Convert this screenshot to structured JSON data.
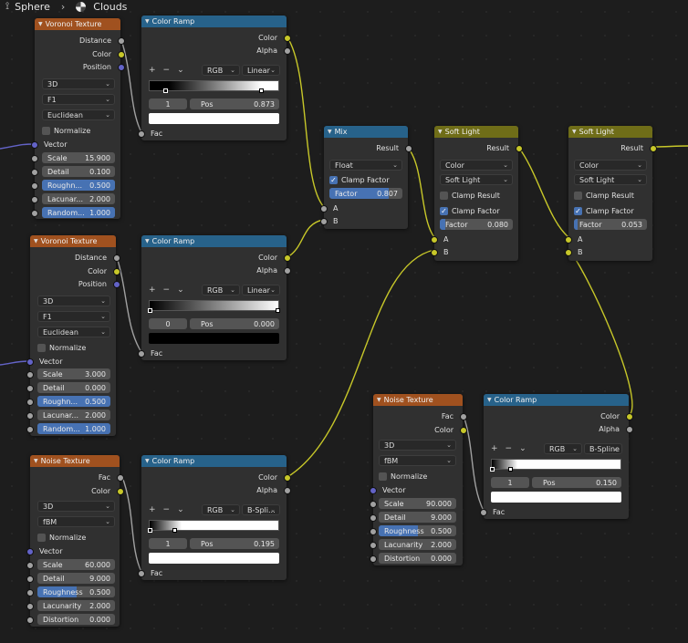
{
  "breadcrumb": {
    "object": "Sphere",
    "material": "Clouds"
  },
  "colors": {
    "texture_header": "#a0511f",
    "converter_header": "#27628a",
    "color_header": "#6f6d18",
    "field_fill": "#4772b3",
    "socket_vector": "#6363c7",
    "socket_color": "#c7c729",
    "socket_float": "#a1a1a1"
  },
  "voronoi1": {
    "title": "Voronoi Texture",
    "outputs": [
      "Distance",
      "Color",
      "Position"
    ],
    "dim": "3D",
    "feature": "F1",
    "metric": "Euclidean",
    "normalize": "Normalize",
    "vector": "Vector",
    "fields": [
      {
        "label": "Scale",
        "value": "15.900"
      },
      {
        "label": "Detail",
        "value": "0.100"
      },
      {
        "label": "Roughn...",
        "value": "0.500",
        "fill": 1
      },
      {
        "label": "Lacunar...",
        "value": "2.000"
      },
      {
        "label": "Random...",
        "value": "1.000",
        "fill": 1
      }
    ]
  },
  "voronoi2": {
    "title": "Voronoi Texture",
    "outputs": [
      "Distance",
      "Color",
      "Position"
    ],
    "dim": "3D",
    "feature": "F1",
    "metric": "Euclidean",
    "normalize": "Normalize",
    "vector": "Vector",
    "fields": [
      {
        "label": "Scale",
        "value": "3.000"
      },
      {
        "label": "Detail",
        "value": "0.000"
      },
      {
        "label": "Roughn...",
        "value": "0.500",
        "fill": 1
      },
      {
        "label": "Lacunar...",
        "value": "2.000"
      },
      {
        "label": "Random...",
        "value": "1.000",
        "fill": 1
      }
    ]
  },
  "noise1": {
    "title": "Noise Texture",
    "outputs": [
      "Fac",
      "Color"
    ],
    "dim": "3D",
    "type": "fBM",
    "normalize": "Normalize",
    "vector": "Vector",
    "fields": [
      {
        "label": "Scale",
        "value": "60.000"
      },
      {
        "label": "Detail",
        "value": "9.000"
      },
      {
        "label": "Roughness",
        "value": "0.500",
        "fill": 0.5
      },
      {
        "label": "Lacunarity",
        "value": "2.000"
      },
      {
        "label": "Distortion",
        "value": "0.000"
      }
    ]
  },
  "noise2": {
    "title": "Noise Texture",
    "outputs": [
      "Fac",
      "Color"
    ],
    "dim": "3D",
    "type": "fBM",
    "normalize": "Normalize",
    "vector": "Vector",
    "fields": [
      {
        "label": "Scale",
        "value": "90.000"
      },
      {
        "label": "Detail",
        "value": "9.000"
      },
      {
        "label": "Roughness",
        "value": "0.500",
        "fill": 0.5
      },
      {
        "label": "Lacunarity",
        "value": "2.000"
      },
      {
        "label": "Distortion",
        "value": "0.000"
      }
    ]
  },
  "ramp1": {
    "title": "Color Ramp",
    "out_color": "Color",
    "out_alpha": "Alpha",
    "mode": "RGB",
    "interp": "Linear",
    "index": "1",
    "pos_label": "Pos",
    "pos": "0.873",
    "fac": "Fac"
  },
  "ramp2": {
    "title": "Color Ramp",
    "out_color": "Color",
    "out_alpha": "Alpha",
    "mode": "RGB",
    "interp": "Linear",
    "index": "0",
    "pos_label": "Pos",
    "pos": "0.000",
    "fac": "Fac"
  },
  "ramp3": {
    "title": "Color Ramp",
    "out_color": "Color",
    "out_alpha": "Alpha",
    "mode": "RGB",
    "interp": "B-Spli...",
    "index": "1",
    "pos_label": "Pos",
    "pos": "0.195",
    "fac": "Fac"
  },
  "ramp4": {
    "title": "Color Ramp",
    "out_color": "Color",
    "out_alpha": "Alpha",
    "mode": "RGB",
    "interp": "B-Spline",
    "index": "1",
    "pos_label": "Pos",
    "pos": "0.150",
    "fac": "Fac"
  },
  "mix": {
    "title": "Mix",
    "result": "Result",
    "type": "Float",
    "clamp": "Clamp Factor",
    "factor_label": "Factor",
    "factor": "0.807",
    "factor_fill": 0.807,
    "a": "A",
    "b": "B"
  },
  "soft1": {
    "title": "Soft Light",
    "result": "Result",
    "type": "Color",
    "blend": "Soft Light",
    "clamp_result": "Clamp Result",
    "clamp_factor": "Clamp Factor",
    "factor_label": "Factor",
    "factor": "0.080",
    "factor_fill": 0.08,
    "a": "A",
    "b": "B"
  },
  "soft2": {
    "title": "Soft Light",
    "result": "Result",
    "type": "Color",
    "blend": "Soft Light",
    "clamp_result": "Clamp Result",
    "clamp_factor": "Clamp Factor",
    "factor_label": "Factor",
    "factor": "0.053",
    "factor_fill": 0.053,
    "a": "A",
    "b": "B"
  },
  "ramp_tools": {
    "add": "+",
    "remove": "−",
    "menu": "⌄"
  }
}
